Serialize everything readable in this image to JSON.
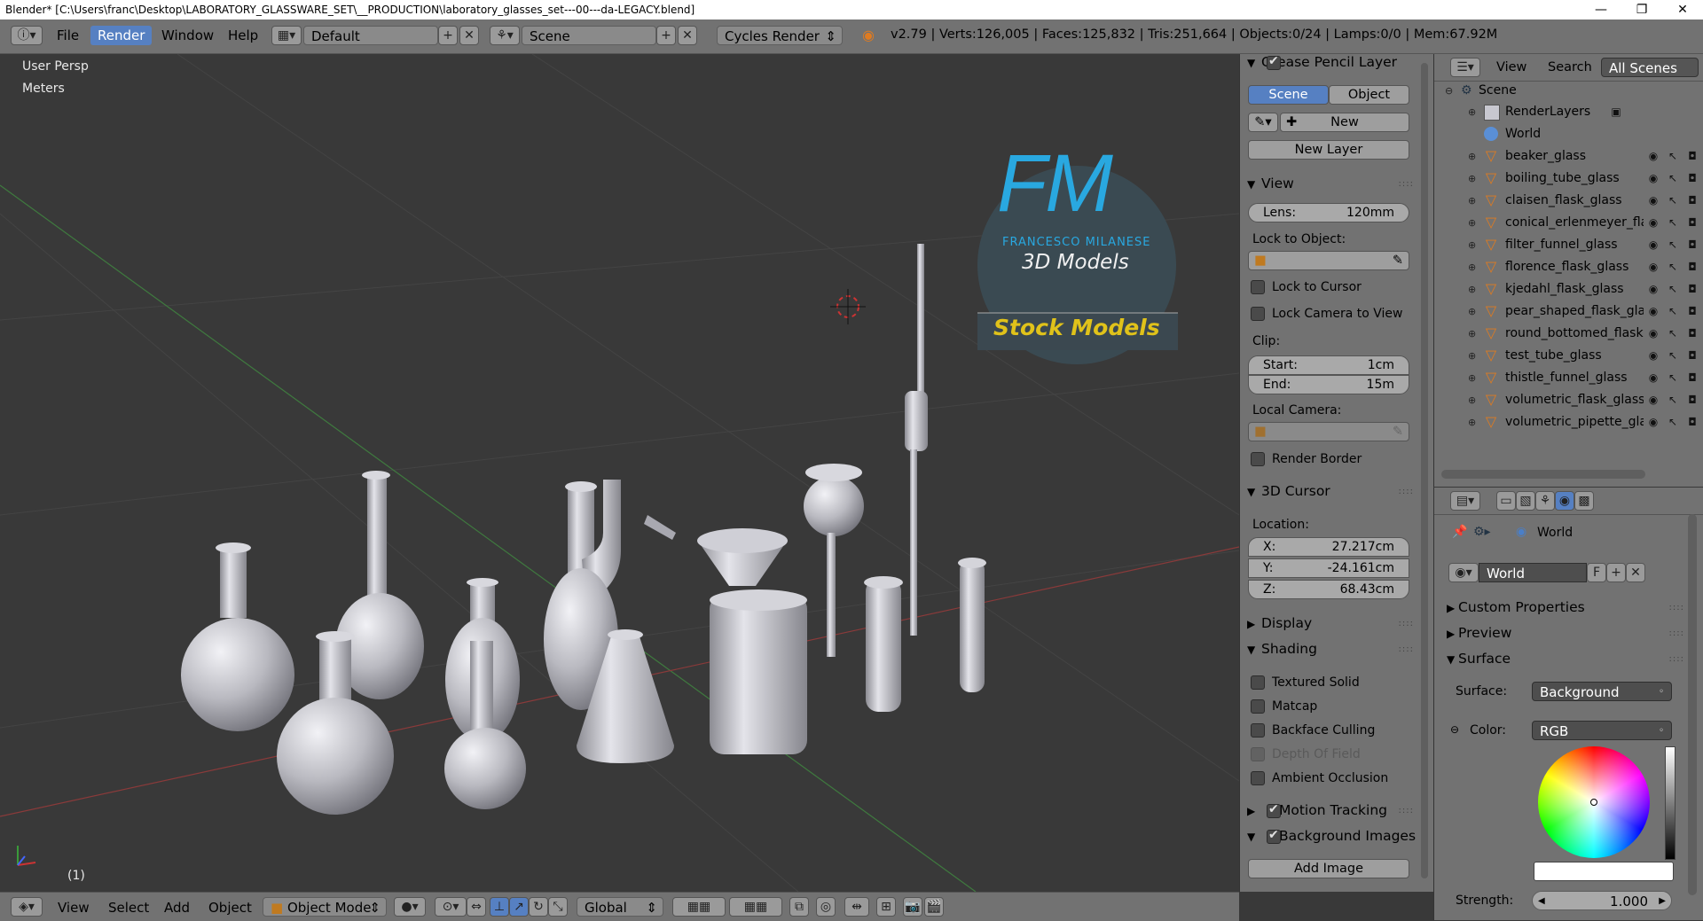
{
  "window": {
    "title": "Blender* [C:\\Users\\franc\\Desktop\\LABORATORY_GLASSWARE_SET\\__PRODUCTION\\laboratory_glasses_set---00---da-LEGACY.blend]",
    "minimize": "—",
    "maximize": "❐",
    "close": "✕"
  },
  "topbar": {
    "menus": [
      "File",
      "Render",
      "Window",
      "Help"
    ],
    "active_menu": "Render",
    "layout": "Default",
    "scene": "Scene",
    "engine": "Cycles Render",
    "stats": "v2.79 | Verts:126,005 | Faces:125,832 | Tris:251,664 | Objects:0/24 | Lamps:0/0 | Mem:67.92M"
  },
  "viewport": {
    "view_name": "User Persp",
    "units": "Meters",
    "frame": "(1)",
    "logo": {
      "initials": "FM",
      "name": "FRANCESCO MILANESE",
      "subtitle": "3D Models",
      "banner": "Stock Models"
    }
  },
  "npanel": {
    "gp": {
      "header": "Grease Pencil Layer",
      "tab_scene": "Scene",
      "tab_object": "Object",
      "new_label": "New",
      "new_layer": "New Layer"
    },
    "view": {
      "header": "View",
      "lens_label": "Lens:",
      "lens_value": "120mm",
      "lock_object": "Lock to Object:",
      "lock_cursor": "Lock to Cursor",
      "lock_camera": "Lock Camera to View",
      "clip": "Clip:",
      "start_label": "Start:",
      "start_value": "1cm",
      "end_label": "End:",
      "end_value": "15m",
      "local_camera": "Local Camera:",
      "render_border": "Render Border"
    },
    "cursor": {
      "header": "3D Cursor",
      "location": "Location:",
      "x_label": "X:",
      "x_value": "27.217cm",
      "y_label": "Y:",
      "y_value": "-24.161cm",
      "z_label": "Z:",
      "z_value": "68.43cm"
    },
    "display": "Display",
    "shading": {
      "header": "Shading",
      "textured": "Textured Solid",
      "matcap": "Matcap",
      "backface": "Backface Culling",
      "dof": "Depth Of Field",
      "ao": "Ambient Occlusion"
    },
    "motion_tracking": "Motion Tracking",
    "bg_images": "Background Images",
    "add_image": "Add Image"
  },
  "outliner": {
    "view": "View",
    "search": "Search",
    "filter": "All Scenes",
    "scene": "Scene",
    "render_layers": "RenderLayers",
    "world": "World",
    "objects": [
      "beaker_glass",
      "boiling_tube_glass",
      "claisen_flask_glass",
      "conical_erlenmeyer_fla",
      "filter_funnel_glass",
      "florence_flask_glass",
      "kjedahl_flask_glass",
      "pear_shaped_flask_gla",
      "round_bottomed_flask",
      "test_tube_glass",
      "thistle_funnel_glass",
      "volumetric_flask_glass",
      "volumetric_pipette_gla"
    ]
  },
  "props": {
    "breadcrumb": "World",
    "world_name": "World",
    "fake_user": "F",
    "custom_properties": "Custom Properties",
    "preview": "Preview",
    "surface_header": "Surface",
    "surface_label": "Surface:",
    "surface_value": "Background",
    "color_label": "Color:",
    "color_value": "RGB",
    "strength_label": "Strength:",
    "strength_value": "1.000"
  },
  "bottombar": {
    "menus": [
      "View",
      "Select",
      "Add",
      "Object"
    ],
    "mode": "Object Mode",
    "orientation": "Global"
  },
  "colors": {
    "accent": "#5680c2",
    "header": "#727272",
    "viewport": "#393939",
    "logo_blue": "#29a8e0",
    "logo_yellow": "#e0c21a"
  }
}
